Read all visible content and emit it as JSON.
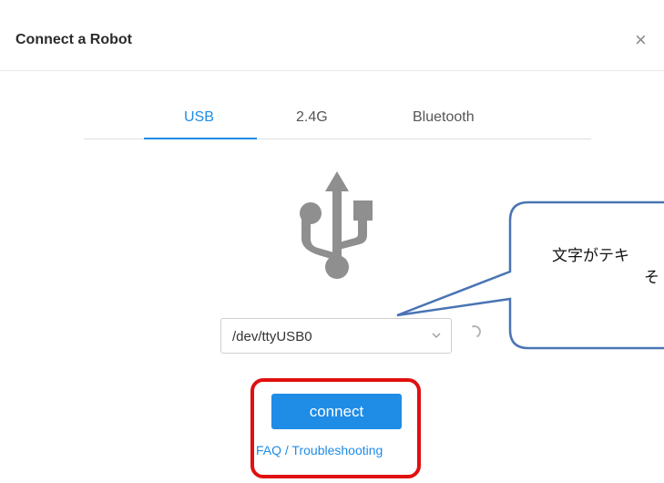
{
  "dialog": {
    "title": "Connect a Robot",
    "close_icon": "×"
  },
  "tabs": [
    {
      "label": "USB",
      "active": true
    },
    {
      "label": "2.4G",
      "active": false
    },
    {
      "label": "Bluetooth",
      "active": false
    }
  ],
  "device": {
    "icon": "usb-icon",
    "selected_port": "/dev/ttyUSB0"
  },
  "actions": {
    "connect_label": "connect",
    "faq_label": "FAQ / Troubleshooting"
  },
  "annotation": {
    "callout_line1": "文字がテキ",
    "callout_line2": "そ"
  },
  "colors": {
    "accent": "#1f8ce6",
    "highlight": "#e01010",
    "callout_border": "#4a74b4"
  }
}
